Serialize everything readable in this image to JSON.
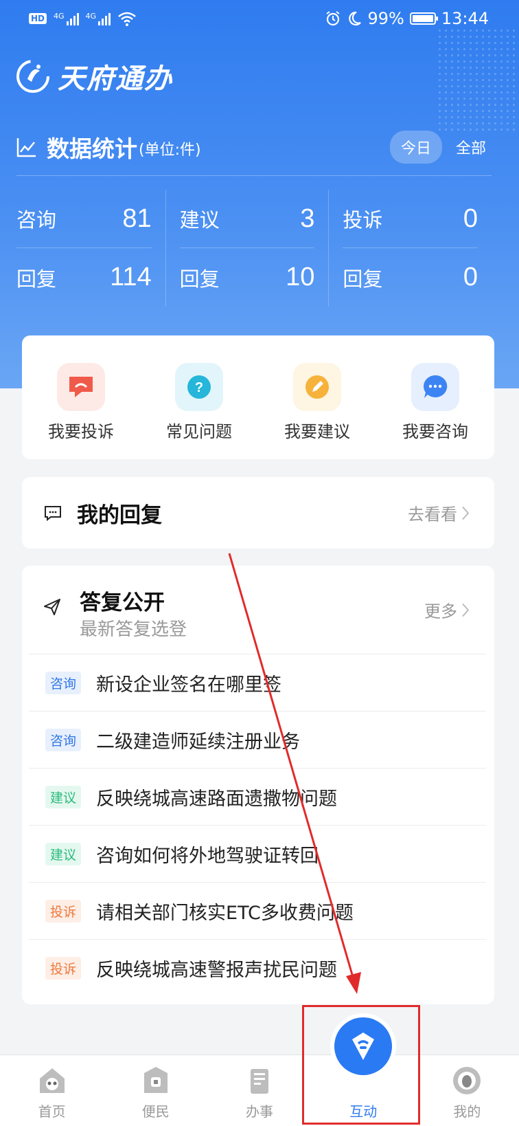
{
  "status_bar": {
    "hd": "HD",
    "signal1": "4G",
    "signal2": "4G",
    "battery_percent": "99%",
    "time": "13:44"
  },
  "app": {
    "title": "天府通办"
  },
  "stats": {
    "title": "数据统计",
    "unit": "(单位:件)",
    "toggle_today": "今日",
    "toggle_all": "全部",
    "columns": [
      {
        "label": "咨询",
        "value": "81",
        "reply_label": "回复",
        "reply_value": "114"
      },
      {
        "label": "建议",
        "value": "3",
        "reply_label": "回复",
        "reply_value": "10"
      },
      {
        "label": "投诉",
        "value": "0",
        "reply_label": "回复",
        "reply_value": "0"
      }
    ]
  },
  "quick_actions": [
    {
      "label": "我要投诉",
      "icon": "complaint-icon",
      "color": "#f05a4a"
    },
    {
      "label": "常见问题",
      "icon": "question-icon",
      "color": "#25b6d9"
    },
    {
      "label": "我要建议",
      "icon": "suggestion-icon",
      "color": "#f6b23a"
    },
    {
      "label": "我要咨询",
      "icon": "consult-icon",
      "color": "#3c84f3"
    }
  ],
  "my_reply": {
    "title": "我的回复",
    "link": "去看看"
  },
  "public": {
    "title": "答复公开",
    "subtitle": "最新答复选登",
    "more": "更多",
    "items": [
      {
        "tag": "咨询",
        "type": "consult",
        "text": "新设企业签名在哪里签"
      },
      {
        "tag": "咨询",
        "type": "consult",
        "text": "二级建造师延续注册业务"
      },
      {
        "tag": "建议",
        "type": "suggest",
        "text": "反映绕城高速路面遗撒物问题"
      },
      {
        "tag": "建议",
        "type": "suggest",
        "text": "咨询如何将外地驾驶证转回"
      },
      {
        "tag": "投诉",
        "type": "complain",
        "text": "请相关部门核实ETC多收费问题"
      },
      {
        "tag": "投诉",
        "type": "complain",
        "text": "反映绕城高速警报声扰民问题"
      }
    ]
  },
  "nav": {
    "items": [
      {
        "label": "首页"
      },
      {
        "label": "便民"
      },
      {
        "label": "办事"
      },
      {
        "label": "互动"
      },
      {
        "label": "我的"
      }
    ],
    "active_index": 3
  },
  "colors": {
    "primary": "#2f7cf0",
    "annotation": "#e12b2b"
  }
}
